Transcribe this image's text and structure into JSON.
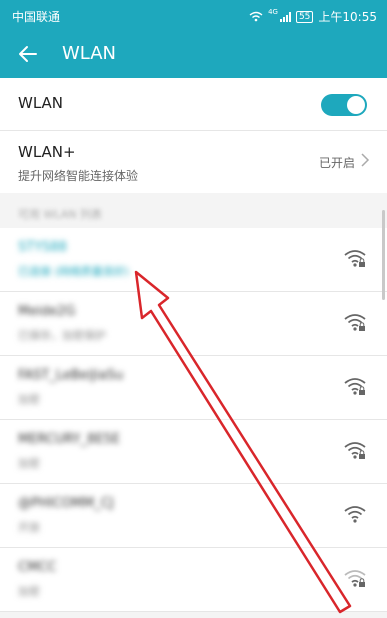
{
  "status_bar": {
    "carrier": "中国联通",
    "network_type": "4G",
    "battery": "55",
    "time": "上午10:55"
  },
  "app_bar": {
    "title": "WLAN",
    "back_icon": "arrow-left-icon"
  },
  "wlan_toggle": {
    "label": "WLAN",
    "enabled": true
  },
  "wlan_plus": {
    "label": "WLAN+",
    "subtitle": "提升网络智能连接体验",
    "status": "已开启"
  },
  "available_networks": {
    "header": "可用 WLAN 列表",
    "items": [
      {
        "ssid": "STYS88",
        "desc": "已连接 (网络质量良好)",
        "connected": true,
        "locked": true
      },
      {
        "ssid": "Meide2G",
        "desc": "已保存，加密保护",
        "connected": false,
        "locked": true
      },
      {
        "ssid": "FAST_LeBeiJiaSu",
        "desc": "加密",
        "connected": false,
        "locked": true
      },
      {
        "ssid": "MERCURY_8E5E",
        "desc": "加密",
        "connected": false,
        "locked": true
      },
      {
        "ssid": "@PHICOMM_CJ",
        "desc": "开放",
        "connected": false,
        "locked": false
      },
      {
        "ssid": "CMCC",
        "desc": "加密",
        "connected": false,
        "locked": true
      }
    ]
  },
  "annotation": {
    "color": "#d9262b"
  },
  "colors": {
    "accent": "#1ea8bd"
  }
}
